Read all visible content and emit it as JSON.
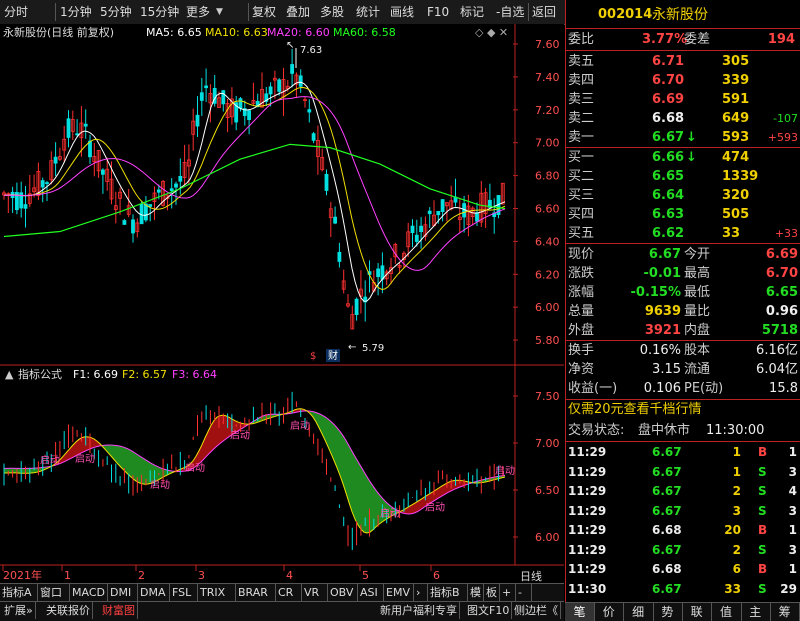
{
  "toolbar": {
    "items": [
      "分时",
      "1分钟",
      "5分钟",
      "15分钟",
      "更多",
      "复权",
      "叠加",
      "多股",
      "统计",
      "画线",
      "F10",
      "标记",
      "-自选",
      "返回"
    ]
  },
  "stock": {
    "code": "002014",
    "name": "永新股份"
  },
  "main_chart": {
    "title": "永新股份(日线 前复权)",
    "ma_labels": [
      "MA5: 6.65",
      "MA10: 6.63",
      "MA20: 6.60",
      "MA60: 6.58"
    ],
    "ma_colors": [
      "#ffffff",
      "#f0e000",
      "#ff40ff",
      "#20ff20"
    ],
    "y_ticks": [
      "7.60",
      "7.40",
      "7.20",
      "7.00",
      "6.80",
      "6.60",
      "6.40",
      "6.20",
      "6.00",
      "5.80"
    ],
    "high_mark": "7.63",
    "low_mark": "5.79",
    "finance_mark": "财",
    "dollar_mark": "$"
  },
  "indicator_chart": {
    "title": "指标公式",
    "f_labels": [
      "F1: 6.69",
      "F2: 6.57",
      "F3: 6.64"
    ],
    "y_ticks": [
      "7.50",
      "7.00",
      "6.50",
      "6.00"
    ],
    "start_label": "启动"
  },
  "x_axis": {
    "labels": [
      "2021年",
      "1",
      "2",
      "3",
      "4",
      "5",
      "6"
    ],
    "right_label": "日线"
  },
  "indicator_tabs": [
    "指标A",
    "窗口",
    "MACD",
    "DMI",
    "DMA",
    "FSL",
    "TRIX",
    "BRAR",
    "CR",
    "VR",
    "OBV",
    "ASI",
    "EMV",
    "›",
    "指标B",
    "模",
    "板",
    "+",
    "-"
  ],
  "bottom_tabs": [
    "扩展»",
    "关联报价",
    "财富图"
  ],
  "bottom_right_tabs": [
    "新用户福利专享",
    "图文F10",
    "侧边栏《"
  ],
  "quote": {
    "webi_label": "委比",
    "webi_value": "3.77%",
    "weicha_label": "委差",
    "weicha_value": "194",
    "asks": [
      {
        "label": "卖五",
        "price": "6.71",
        "vol": "305",
        "chg": ""
      },
      {
        "label": "卖四",
        "price": "6.70",
        "vol": "339",
        "chg": ""
      },
      {
        "label": "卖三",
        "price": "6.69",
        "vol": "591",
        "chg": ""
      },
      {
        "label": "卖二",
        "price": "6.68",
        "vol": "649",
        "chg": "-107"
      },
      {
        "label": "卖一",
        "price": "6.67",
        "vol": "593",
        "chg": "+593",
        "arrow": "↓"
      }
    ],
    "bids": [
      {
        "label": "买一",
        "price": "6.66",
        "vol": "474",
        "chg": "",
        "arrow": "↓"
      },
      {
        "label": "买二",
        "price": "6.65",
        "vol": "1339",
        "chg": ""
      },
      {
        "label": "买三",
        "price": "6.64",
        "vol": "320",
        "chg": ""
      },
      {
        "label": "买四",
        "price": "6.63",
        "vol": "505",
        "chg": ""
      },
      {
        "label": "买五",
        "price": "6.62",
        "vol": "33",
        "chg": "+33"
      }
    ],
    "stats": [
      {
        "l1": "现价",
        "v1": "6.67",
        "l2": "今开",
        "v2": "6.69"
      },
      {
        "l1": "涨跌",
        "v1": "-0.01",
        "l2": "最高",
        "v2": "6.70"
      },
      {
        "l1": "涨幅",
        "v1": "-0.15%",
        "l2": "最低",
        "v2": "6.65"
      },
      {
        "l1": "总量",
        "v1": "9639",
        "l2": "量比",
        "v2": "0.96"
      },
      {
        "l1": "外盘",
        "v1": "3921",
        "l2": "内盘",
        "v2": "5718"
      }
    ],
    "stats2": [
      {
        "l1": "换手",
        "v1": "0.16%",
        "l2": "股本",
        "v2": "6.16亿"
      },
      {
        "l1": "净资",
        "v1": "3.15",
        "l2": "流通",
        "v2": "6.04亿"
      },
      {
        "l1": "收益(一)",
        "v1": "0.106",
        "l2": "PE(动)",
        "v2": "15.8"
      }
    ],
    "promo": "仅需20元查看千档行情",
    "trade_status_label": "交易状态:",
    "trade_status": "盘中休市",
    "trade_time": "11:30:00"
  },
  "ticks": [
    {
      "time": "11:29",
      "price": "6.67",
      "vol": "1",
      "bs": "B",
      "n": "1"
    },
    {
      "time": "11:29",
      "price": "6.67",
      "vol": "1",
      "bs": "S",
      "n": "3"
    },
    {
      "time": "11:29",
      "price": "6.67",
      "vol": "2",
      "bs": "S",
      "n": "4"
    },
    {
      "time": "11:29",
      "price": "6.67",
      "vol": "3",
      "bs": "S",
      "n": "3"
    },
    {
      "time": "11:29",
      "price": "6.68",
      "vol": "20",
      "bs": "B",
      "n": "1"
    },
    {
      "time": "11:29",
      "price": "6.67",
      "vol": "2",
      "bs": "S",
      "n": "3"
    },
    {
      "time": "11:29",
      "price": "6.68",
      "vol": "6",
      "bs": "B",
      "n": "1"
    },
    {
      "time": "11:30",
      "price": "6.67",
      "vol": "33",
      "bs": "S",
      "n": "29"
    }
  ],
  "side_buttons": [
    "笔",
    "价",
    "细",
    "势",
    "联",
    "值",
    "主",
    "筹"
  ]
}
